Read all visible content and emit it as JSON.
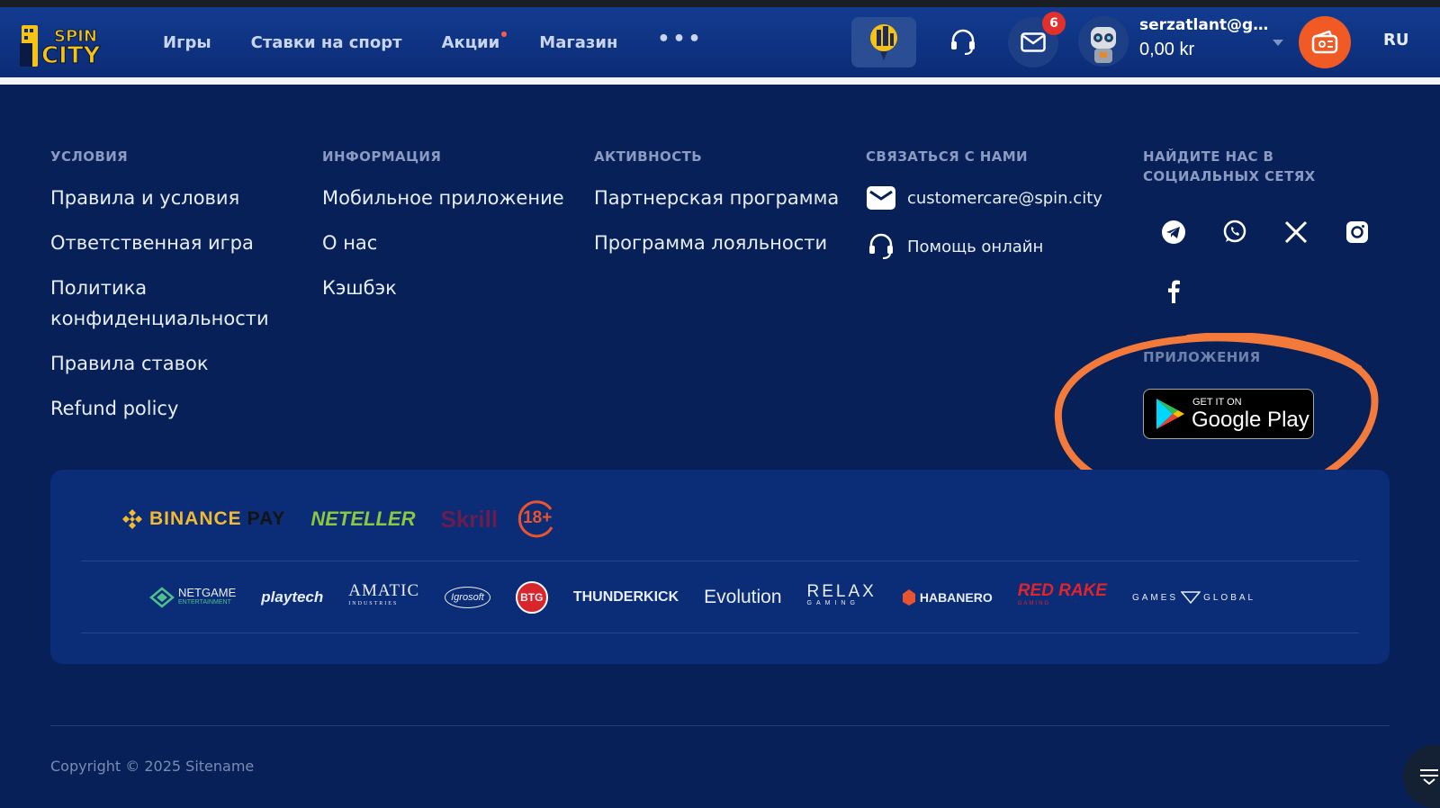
{
  "header": {
    "logo_text_top": "SPIN",
    "logo_text_bottom": "CITY",
    "nav": [
      "Игры",
      "Ставки на спорт",
      "Акции",
      "Магазин"
    ],
    "more": "•••",
    "mail_badge": "6",
    "user_email": "serzatlant@gma...",
    "balance": "0,00 kr",
    "lang": "RU"
  },
  "footer": {
    "terms": {
      "title": "УСЛОВИЯ",
      "links": [
        "Правила и условия",
        "Ответственная игра",
        "Политика конфиденциальности",
        "Правила ставок",
        "Refund policy"
      ]
    },
    "info": {
      "title": "ИНФОРМАЦИЯ",
      "links": [
        "Мобильное приложение",
        "О нас",
        "Кэшбэк"
      ]
    },
    "activity": {
      "title": "АКТИВНОСТЬ",
      "links": [
        "Партнерская программа",
        "Программа лояльности"
      ]
    },
    "contact": {
      "title": "СВЯЗАТЬСЯ С НАМИ",
      "email": "customercare@spin.city",
      "online_help": "Помощь онлайн"
    },
    "social": {
      "title": "НАЙДИТЕ НАС В СОЦИАЛЬНЫХ СЕТЯХ",
      "icons": [
        "telegram-icon",
        "whatsapp-icon",
        "x-icon",
        "instagram-icon",
        "facebook-icon"
      ]
    },
    "apps": {
      "title": "ПРИЛОЖЕНИЯ",
      "gplay_small": "GET IT ON",
      "gplay_big": "Google Play"
    },
    "payments": {
      "binance": "BINANCE",
      "binance_pay": "PAY",
      "neteller": "NETELLER",
      "skrill": "Skrill",
      "age": "18+"
    },
    "providers": [
      "NETGAME",
      "ENTERTAINMENT",
      "playtech",
      "AMATIC",
      "INDUSTRIES",
      "Igrosoft",
      "BTG",
      "THUNDERKICK",
      "Evolution",
      "RELAX",
      "GAMING",
      "HABANERO",
      "RED RAKE",
      "GAMING",
      "GAMES",
      "GLOBAL"
    ],
    "copyright": "Copyright © 2025 Sitename"
  },
  "colors": {
    "background": "#072057",
    "header": "#123c91",
    "accent_orange": "#f15a24",
    "badge_red": "#e2302d",
    "annotation_circle": "#f47a3c"
  }
}
